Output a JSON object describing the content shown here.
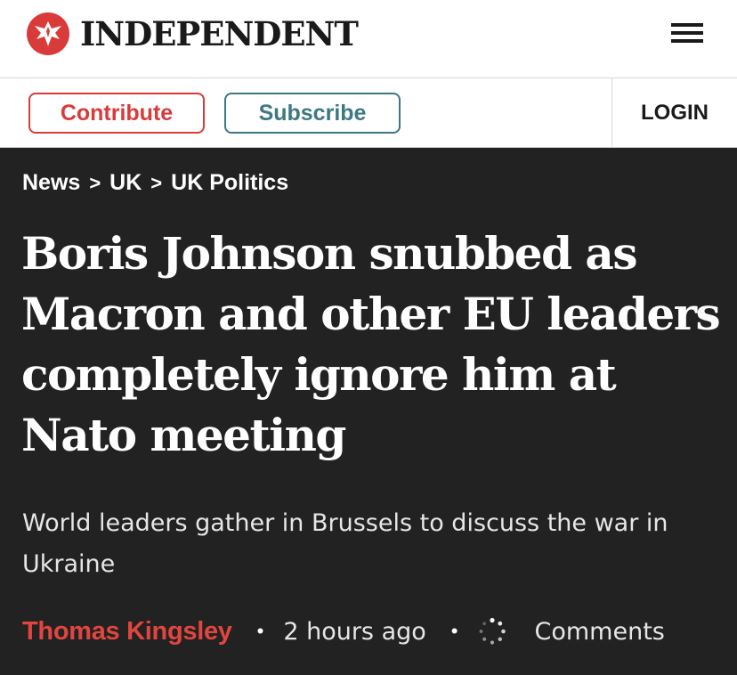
{
  "header": {
    "logo_text": "INDEPENDENT",
    "logo_icon": "eagle-icon",
    "menu_icon": "hamburger-menu-icon"
  },
  "actions": {
    "contribute_label": "Contribute",
    "subscribe_label": "Subscribe",
    "login_label": "LOGIN"
  },
  "breadcrumb": {
    "items": [
      "News",
      "UK",
      "UK Politics"
    ],
    "separator": ">"
  },
  "article": {
    "headline_lines": [
      "Boris Johnson snubbed as",
      "Macron and other EU leaders",
      "completely ignore him at",
      "Nato meeting"
    ],
    "standfirst_lines": [
      "World leaders gather in Brussels to discuss the war in",
      "Ukraine"
    ],
    "author": "Thomas Kingsley",
    "published": "2 hours ago",
    "separator": "•",
    "comments_icon": "loading-spinner-icon",
    "comments_label": "Comments"
  },
  "colors": {
    "brand_red": "#d93a3a",
    "author_red": "#e0463f",
    "subscribe_teal": "#3d7883",
    "article_bg": "#222222"
  }
}
